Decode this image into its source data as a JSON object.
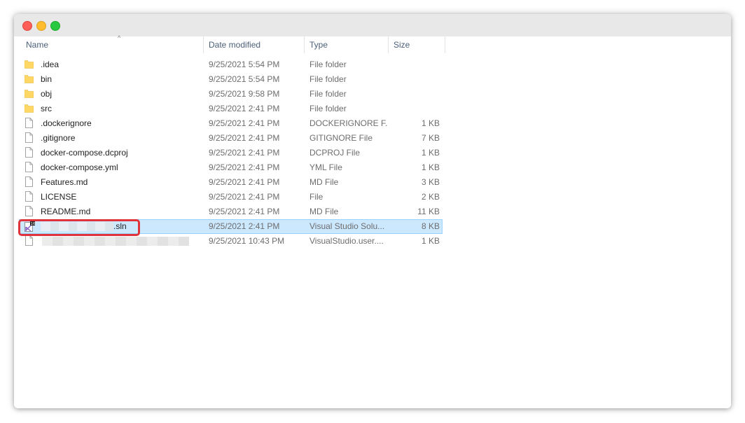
{
  "window": {
    "controls": [
      "close",
      "minimize",
      "maximize"
    ]
  },
  "columns": {
    "name": "Name",
    "date": "Date modified",
    "type": "Type",
    "size": "Size",
    "sort_indicator": "^"
  },
  "files": [
    {
      "name": ".idea",
      "date": "9/25/2021 5:54 PM",
      "type": "File folder",
      "size": "",
      "icon": "folder-icon"
    },
    {
      "name": "bin",
      "date": "9/25/2021 5:54 PM",
      "type": "File folder",
      "size": "",
      "icon": "folder-icon"
    },
    {
      "name": "obj",
      "date": "9/25/2021 9:58 PM",
      "type": "File folder",
      "size": "",
      "icon": "folder-icon"
    },
    {
      "name": "src",
      "date": "9/25/2021 2:41 PM",
      "type": "File folder",
      "size": "",
      "icon": "folder-icon"
    },
    {
      "name": ".dockerignore",
      "date": "9/25/2021 2:41 PM",
      "type": "DOCKERIGNORE F...",
      "size": "1 KB",
      "icon": "file-icon"
    },
    {
      "name": ".gitignore",
      "date": "9/25/2021 2:41 PM",
      "type": "GITIGNORE File",
      "size": "7 KB",
      "icon": "file-icon"
    },
    {
      "name": "docker-compose.dcproj",
      "date": "9/25/2021 2:41 PM",
      "type": "DCPROJ File",
      "size": "1 KB",
      "icon": "file-icon"
    },
    {
      "name": "docker-compose.yml",
      "date": "9/25/2021 2:41 PM",
      "type": "YML File",
      "size": "1 KB",
      "icon": "file-icon"
    },
    {
      "name": "Features.md",
      "date": "9/25/2021 2:41 PM",
      "type": "MD File",
      "size": "3 KB",
      "icon": "file-icon"
    },
    {
      "name": "LICENSE",
      "date": "9/25/2021 2:41 PM",
      "type": "File",
      "size": "2 KB",
      "icon": "file-icon"
    },
    {
      "name": "README.md",
      "date": "9/25/2021 2:41 PM",
      "type": "MD File",
      "size": "11 KB",
      "icon": "file-icon"
    },
    {
      "name": ".sln",
      "date": "9/25/2021 2:41 PM",
      "type": "Visual Studio Solu...",
      "size": "8 KB",
      "icon": "visual-studio-solution-icon",
      "selected": true,
      "name_redacted": true,
      "highlighted": true
    },
    {
      "name": "",
      "date": "9/25/2021 10:43 PM",
      "type": "VisualStudio.user....",
      "size": "1 KB",
      "icon": "file-icon",
      "name_redacted": true
    }
  ],
  "colors": {
    "selection_bg": "#cce8ff",
    "selection_border": "#99d1ff",
    "highlight_border": "#e0333b",
    "folder": "#ffd765",
    "header_text": "#4c607a"
  }
}
